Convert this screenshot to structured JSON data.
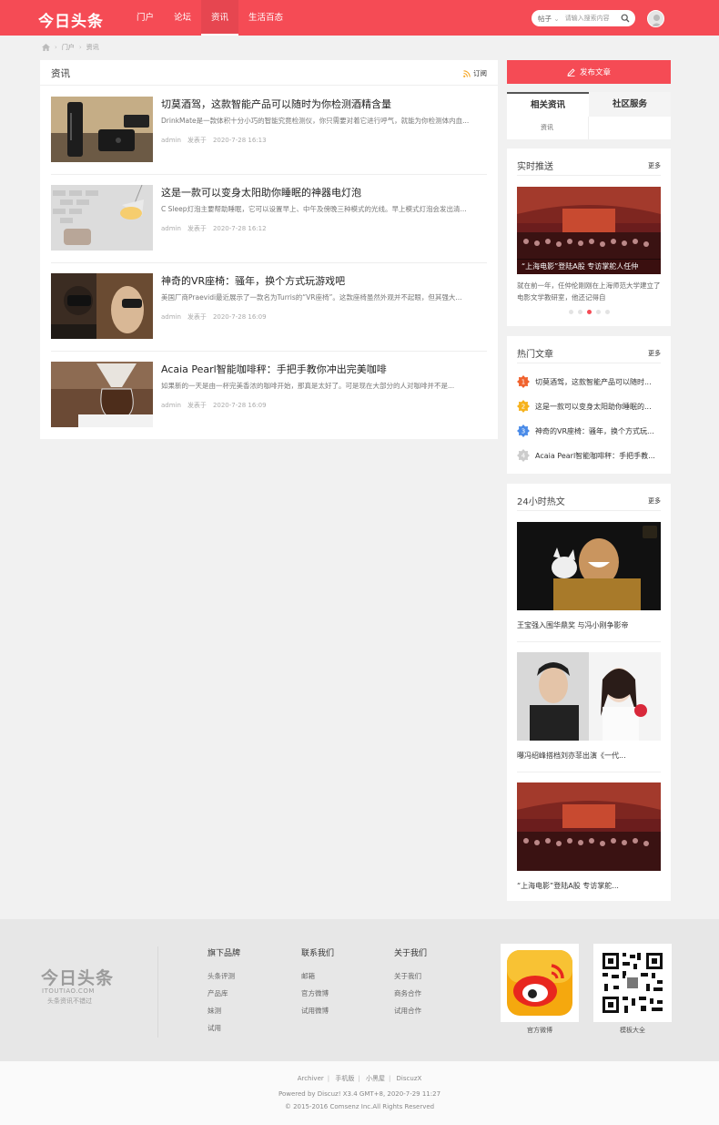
{
  "header": {
    "logo": "今日头条",
    "nav": [
      {
        "label": "门户",
        "active": false
      },
      {
        "label": "论坛",
        "active": false
      },
      {
        "label": "资讯",
        "active": true
      },
      {
        "label": "生活百态",
        "active": false
      }
    ],
    "search": {
      "type": "帖子",
      "placeholder": "请输入搜索内容"
    }
  },
  "breadcrumb": {
    "items": [
      "门户",
      "资讯"
    ]
  },
  "main": {
    "title": "资讯",
    "subscribe": "订阅",
    "articles": [
      {
        "title": "切莫酒驾，这款智能产品可以随时为你检测酒精含量",
        "summary": "DrinkMate是一款体积十分小巧的智能究竟检测仪，你只需要对着它进行呼气，就能为你检测体内血...",
        "author": "admin",
        "published": "发表于",
        "date": "2020-7-28 16:13"
      },
      {
        "title": "这是一款可以变身太阳助你睡眠的神器电灯泡",
        "summary": "C Sleep灯泡主要帮助睡眠，它可以设置早上、中午及傍晚三种模式的光线。早上模式灯泡会发出清...",
        "author": "admin",
        "published": "发表于",
        "date": "2020-7-28 16:12"
      },
      {
        "title": "神奇的VR座椅：骚年，换个方式玩游戏吧",
        "summary": "美国厂商Praevidi最近展示了一款名为Turris的“VR座椅”。这款座椅虽然外观并不起眼，但其强大...",
        "author": "admin",
        "published": "发表于",
        "date": "2020-7-28 16:09"
      },
      {
        "title": "Acaia Pearl智能咖啡秤：手把手教你冲出完美咖啡",
        "summary": "如果新的一天是由一杯完美香浓的咖啡开始，那真是太好了。可是现在大部分的人对咖啡并不是...",
        "author": "admin",
        "published": "发表于",
        "date": "2020-7-28 16:09"
      }
    ]
  },
  "sidebar": {
    "post_button": "发布文章",
    "tabs": [
      {
        "label": "相关资讯",
        "active": true
      },
      {
        "label": "社区服务",
        "active": false
      }
    ],
    "tab_sub": "资讯",
    "more": "更多",
    "realtime": {
      "title": "实时推送",
      "caption": "“上海电影”登陆A股 专访掌舵人任仲",
      "desc": "就在前一年，任仲伦刚刚在上海师范大学建立了电影文学教研室，他还记得自",
      "dots": 5,
      "active_dot": 3
    },
    "hot": {
      "title": "热门文章",
      "items": [
        {
          "rank": "1",
          "title": "切莫酒驾，这款智能产品可以随时...",
          "color": "#f0622d"
        },
        {
          "rank": "2",
          "title": "这是一款可以变身太阳助你睡眠的...",
          "color": "#f6b21c"
        },
        {
          "rank": "3",
          "title": "神奇的VR座椅：骚年，换个方式玩...",
          "color": "#4a8be8"
        },
        {
          "rank": "4",
          "title": "Acaia Pearl智能咖啡秤：手把手教...",
          "color": "#cccccc"
        }
      ]
    },
    "day24": {
      "title": "24小时热文",
      "items": [
        {
          "caption": "王宝强入围华鼎奖 与冯小刚争影帝"
        },
        {
          "caption": "曝冯绍峰搭档刘亦菲出演《一代..."
        },
        {
          "caption": "“上海电影”登陆A股 专访掌舵..."
        }
      ]
    }
  },
  "footer": {
    "logo": "今日头条",
    "logo_domain": "ITOUTIAO.COM",
    "logo_slogan": "头条资讯不错过",
    "columns": [
      {
        "title": "旗下品牌",
        "links": [
          "头条评测",
          "产品库",
          "妹测",
          "试用"
        ]
      },
      {
        "title": "联系我们",
        "links": [
          "邮箱",
          "官方微博",
          "试用微博"
        ]
      },
      {
        "title": "关于我们",
        "links": [
          "关于我们",
          "商务合作",
          "试用合作"
        ]
      }
    ],
    "qr": [
      {
        "caption": "官方微博"
      },
      {
        "caption": "模板大全"
      }
    ]
  },
  "bottom": {
    "links": [
      "Archiver",
      "手机版",
      "小黑屋",
      "DiscuzX"
    ],
    "powered": "Powered by Discuz! X3.4 GMT+8, 2020-7-29 11:27",
    "copyright": "© 2015-2016 Comsenz Inc.All Rights Reserved"
  },
  "colors": {
    "brand": "#f54b55"
  }
}
